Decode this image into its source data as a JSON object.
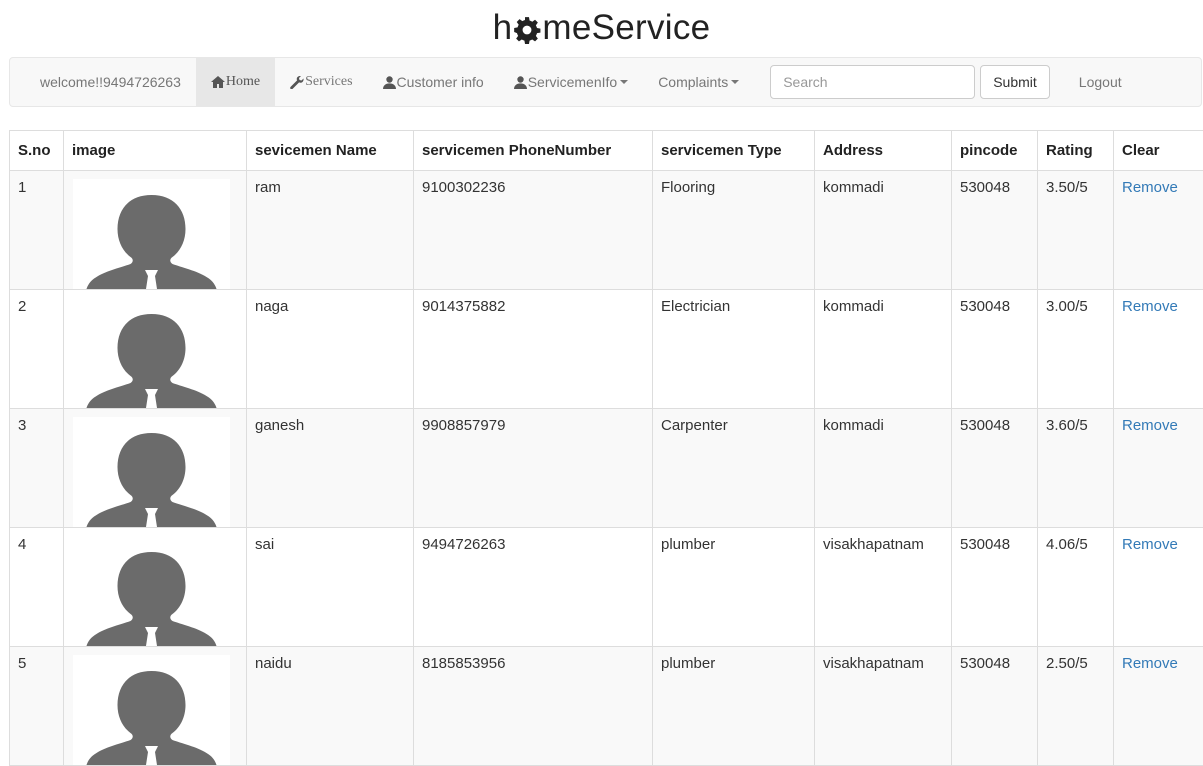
{
  "brand": {
    "prefix": "h",
    "suffix": "meService"
  },
  "navbar": {
    "welcome": "welcome!!9494726263",
    "home": "Home",
    "services": "Services",
    "customer_info": "Customer info",
    "servicemen_info": "ServicemenIfo",
    "complaints": "Complaints",
    "search_placeholder": "Search",
    "submit": "Submit",
    "logout": "Logout"
  },
  "table": {
    "headers": {
      "sno": "S.no",
      "image": "image",
      "name": "sevicemen Name",
      "phone": "servicemen PhoneNumber",
      "type": "servicemen Type",
      "address": "Address",
      "pincode": "pincode",
      "rating": "Rating",
      "clear": "Clear"
    },
    "rows": [
      {
        "sno": "1",
        "name": "ram",
        "phone": "9100302236",
        "type": "Flooring",
        "address": "kommadi",
        "pincode": "530048",
        "rating": "3.50/5",
        "action": "Remove"
      },
      {
        "sno": "2",
        "name": "naga",
        "phone": "9014375882",
        "type": "Electrician",
        "address": "kommadi",
        "pincode": "530048",
        "rating": "3.00/5",
        "action": "Remove"
      },
      {
        "sno": "3",
        "name": "ganesh",
        "phone": "9908857979",
        "type": "Carpenter",
        "address": "kommadi",
        "pincode": "530048",
        "rating": "3.60/5",
        "action": "Remove"
      },
      {
        "sno": "4",
        "name": "sai",
        "phone": "9494726263",
        "type": "plumber",
        "address": "visakhapatnam",
        "pincode": "530048",
        "rating": "4.06/5",
        "action": "Remove"
      },
      {
        "sno": "5",
        "name": "naidu",
        "phone": "8185853956",
        "type": "plumber",
        "address": "visakhapatnam",
        "pincode": "530048",
        "rating": "2.50/5",
        "action": "Remove"
      }
    ]
  },
  "icons": {
    "brand_logo": "gear-icon",
    "home": "home-icon",
    "services": "wrench-icon",
    "customer_info": "user-icon",
    "servicemen_info": "user-icon",
    "avatar": "person-silhouette-icon"
  },
  "colors": {
    "link": "#337ab7",
    "navbar_bg": "#f8f8f8",
    "nav_active_bg": "#e7e7e7",
    "avatar_fill": "#6b6b6b"
  }
}
